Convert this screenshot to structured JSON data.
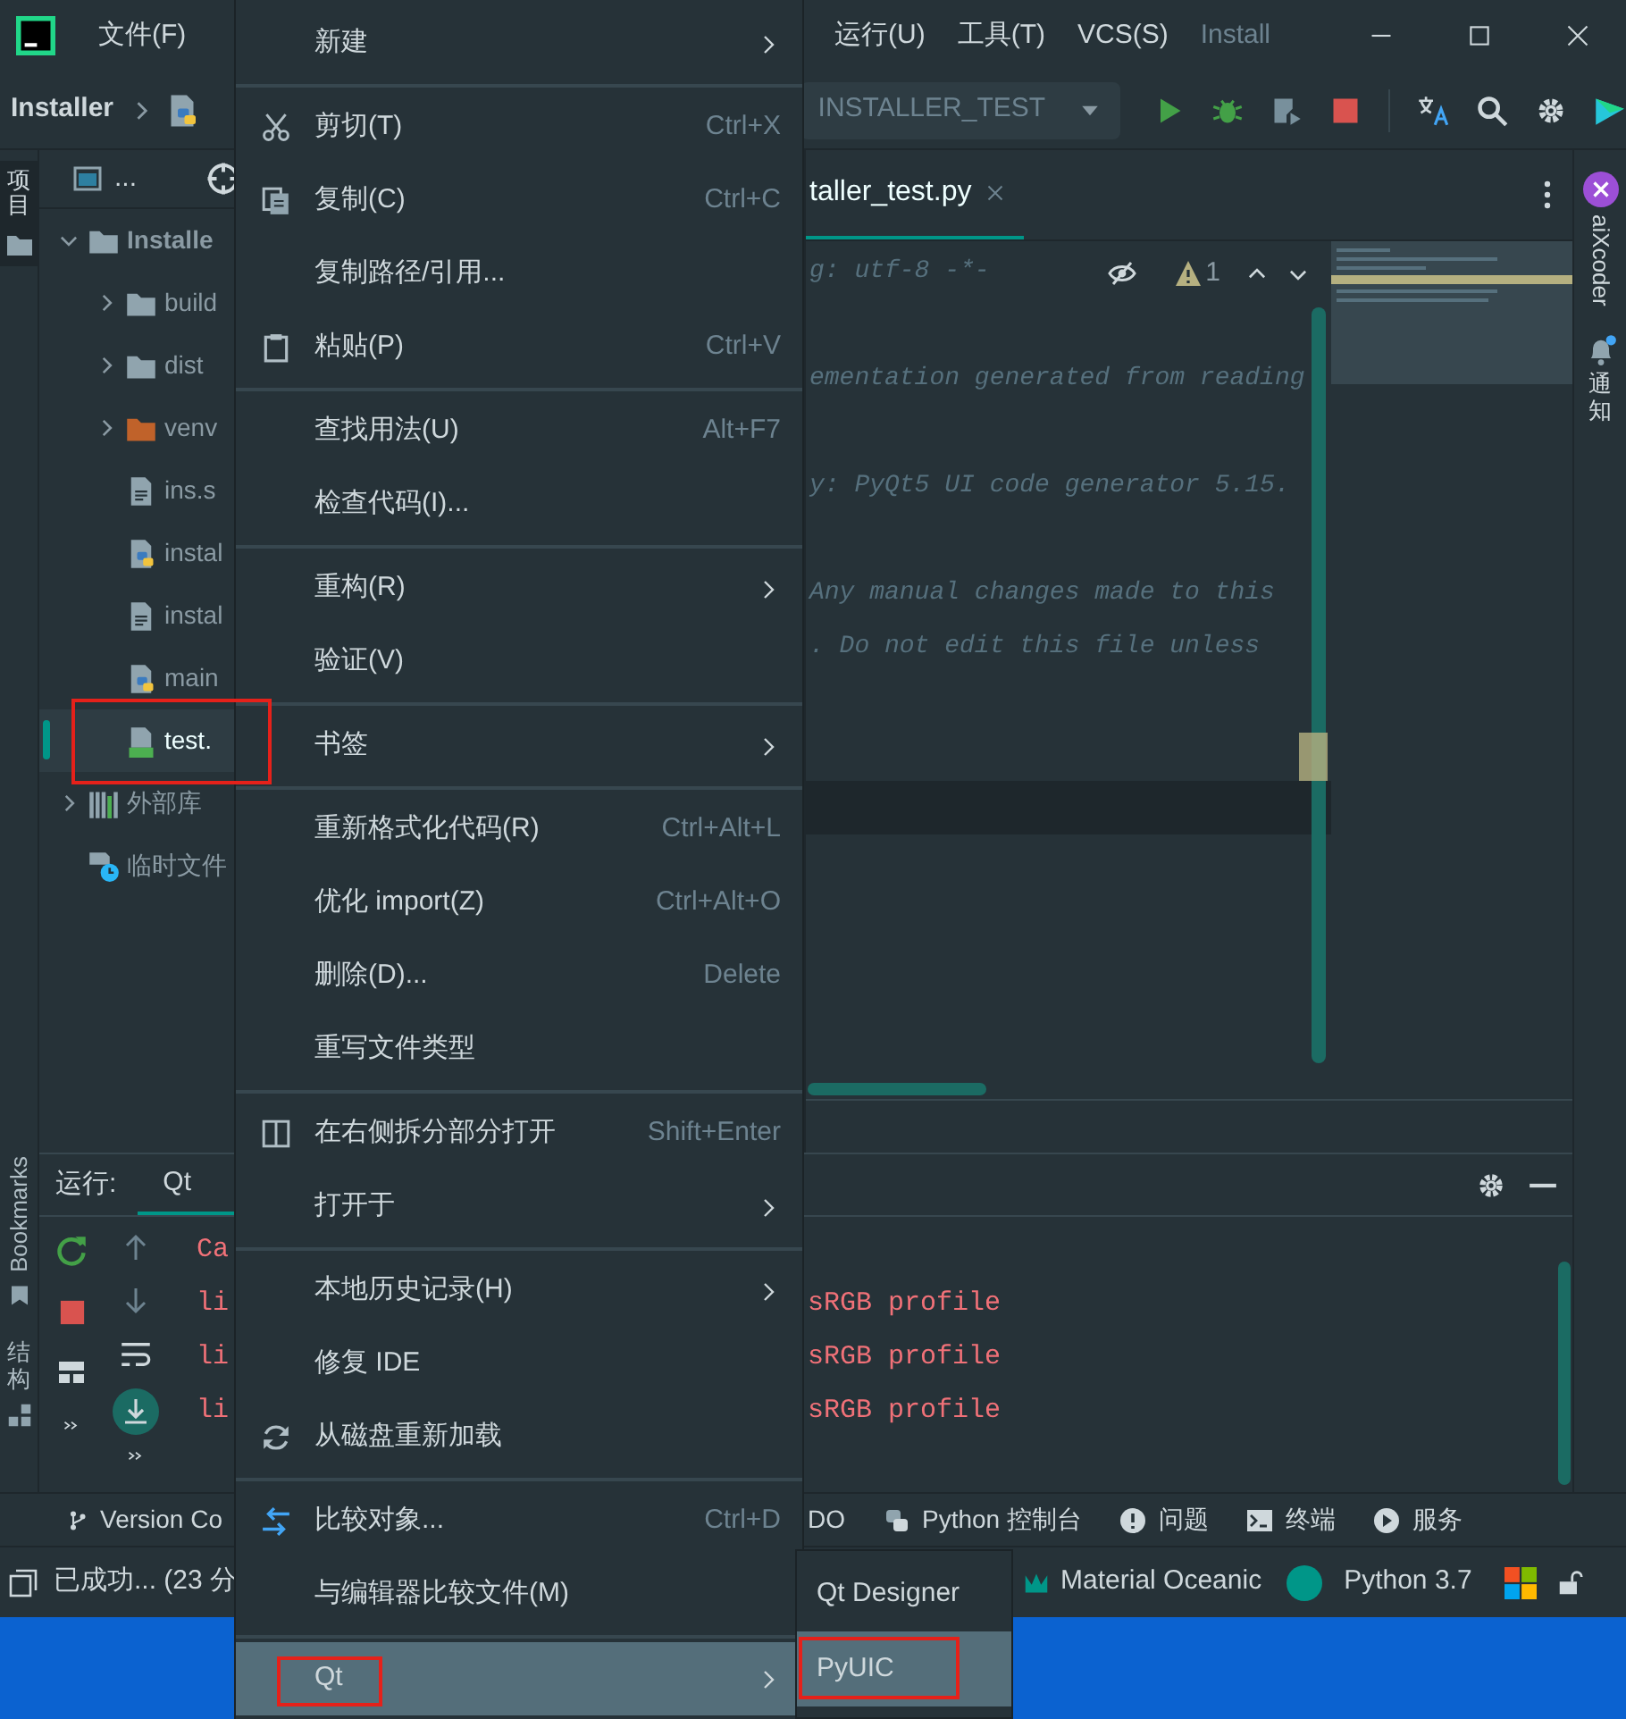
{
  "title_bar": {
    "menus_left": [
      "文件(F)"
    ],
    "menus_right": [
      "运行(U)",
      "工具(T)",
      "VCS(S)"
    ],
    "project": "Install"
  },
  "toolbar": {
    "breadcrumb": "Installer",
    "run_config": "INSTALLER_TEST"
  },
  "left_strip": {
    "top_tabs": [
      {
        "label": "项目",
        "selected": true
      }
    ],
    "bottom_tabs": [
      {
        "label": "Bookmarks",
        "selected": false
      },
      {
        "label": "结构",
        "selected": false
      }
    ]
  },
  "project_panel": {
    "view_selector": "...",
    "tree": [
      {
        "label": "Installe",
        "kind": "folder",
        "expanded": true,
        "selected": false,
        "annotated": false,
        "children": [
          {
            "label": "build",
            "kind": "folder",
            "expanded": false,
            "selected": false,
            "annotated": false
          },
          {
            "label": "dist",
            "kind": "folder",
            "expanded": false,
            "selected": false,
            "annotated": false
          },
          {
            "label": "venv",
            "kind": "excluded_folder",
            "expanded": false,
            "selected": false,
            "annotated": false
          },
          {
            "label": "ins.s",
            "kind": "file",
            "selected": false,
            "annotated": false
          },
          {
            "label": "instal",
            "kind": "python",
            "selected": false,
            "annotated": false
          },
          {
            "label": "instal",
            "kind": "file",
            "selected": false,
            "annotated": false
          },
          {
            "label": "main",
            "kind": "python",
            "selected": false,
            "annotated": false
          },
          {
            "label": "test.",
            "kind": "qt",
            "selected": true,
            "annotated": true
          }
        ]
      },
      {
        "label": "外部库",
        "kind": "library",
        "expanded": false,
        "selected": false,
        "annotated": false
      },
      {
        "label": "临时文件",
        "kind": "scratch",
        "selected": false,
        "annotated": false
      }
    ]
  },
  "editor": {
    "tab": {
      "label": "taller_test.py",
      "selected": true
    },
    "warnings": "1",
    "lines": [
      {
        "kind": "text",
        "text": "g: utf-8 -*-"
      },
      {
        "kind": "blank"
      },
      {
        "kind": "text",
        "text": "ementation generated from reading"
      },
      {
        "kind": "blank"
      },
      {
        "kind": "text",
        "text": "y: PyQt5 UI code generator 5.15."
      },
      {
        "kind": "blank"
      },
      {
        "kind": "text",
        "text": "Any manual changes made to this"
      },
      {
        "kind": "text",
        "text": ".  Do not edit this file unless"
      },
      {
        "kind": "blank"
      },
      {
        "kind": "blank"
      },
      {
        "kind": "current"
      }
    ]
  },
  "right_strip": [
    "aiXcoder",
    "通知"
  ],
  "run_panel": {
    "label": "运行:",
    "tab": {
      "label": "Qt",
      "selected": true
    },
    "output": [
      {
        "start": "Ca"
      },
      {
        "start": "li",
        "end": "sRGB profile"
      },
      {
        "start": "li",
        "end": "sRGB profile"
      },
      {
        "start": "li",
        "end": "sRGB profile"
      }
    ]
  },
  "tool_windows_left": [
    "Version Co"
  ],
  "tool_windows_right": [
    "DO",
    "Python 控制台",
    "问题",
    "终端",
    "服务"
  ],
  "status_bar": {
    "message": "已成功... (23 分",
    "theme": "Material Oceanic",
    "interpreter": "Python 3.7"
  },
  "context_menu": {
    "items": [
      {
        "kind": "item",
        "label": "新建",
        "submenu": true,
        "selected": false,
        "annotated": false
      },
      {
        "kind": "separator"
      },
      {
        "kind": "item",
        "label": "剪切(T)",
        "shortcut": "Ctrl+X",
        "submenu": false,
        "selected": false,
        "annotated": false
      },
      {
        "kind": "item",
        "label": "复制(C)",
        "shortcut": "Ctrl+C",
        "submenu": false,
        "selected": false,
        "annotated": false
      },
      {
        "kind": "item",
        "label": "复制路径/引用...",
        "submenu": false,
        "selected": false,
        "annotated": false
      },
      {
        "kind": "item",
        "label": "粘贴(P)",
        "shortcut": "Ctrl+V",
        "submenu": false,
        "selected": false,
        "annotated": false
      },
      {
        "kind": "separator"
      },
      {
        "kind": "item",
        "label": "查找用法(U)",
        "shortcut": "Alt+F7",
        "submenu": false,
        "selected": false,
        "annotated": false
      },
      {
        "kind": "item",
        "label": "检查代码(I)...",
        "submenu": false,
        "selected": false,
        "annotated": false
      },
      {
        "kind": "separator"
      },
      {
        "kind": "item",
        "label": "重构(R)",
        "submenu": true,
        "selected": false,
        "annotated": false
      },
      {
        "kind": "item",
        "label": "验证(V)",
        "submenu": false,
        "selected": false,
        "annotated": false
      },
      {
        "kind": "separator"
      },
      {
        "kind": "item",
        "label": "书签",
        "submenu": true,
        "selected": false,
        "annotated": false
      },
      {
        "kind": "separator"
      },
      {
        "kind": "item",
        "label": "重新格式化代码(R)",
        "shortcut": "Ctrl+Alt+L",
        "submenu": false,
        "selected": false,
        "annotated": false
      },
      {
        "kind": "item",
        "label": "优化 import(Z)",
        "shortcut": "Ctrl+Alt+O",
        "submenu": false,
        "selected": false,
        "annotated": false
      },
      {
        "kind": "item",
        "label": "删除(D)...",
        "shortcut": "Delete",
        "submenu": false,
        "selected": false,
        "annotated": false
      },
      {
        "kind": "item",
        "label": "重写文件类型",
        "submenu": false,
        "selected": false,
        "annotated": false
      },
      {
        "kind": "separator"
      },
      {
        "kind": "item",
        "label": "在右侧拆分部分打开",
        "shortcut": "Shift+Enter",
        "submenu": false,
        "selected": false,
        "annotated": false
      },
      {
        "kind": "item",
        "label": "打开于",
        "submenu": true,
        "selected": false,
        "annotated": false
      },
      {
        "kind": "separator"
      },
      {
        "kind": "item",
        "label": "本地历史记录(H)",
        "submenu": true,
        "selected": false,
        "annotated": false
      },
      {
        "kind": "item",
        "label": "修复 IDE",
        "submenu": false,
        "selected": false,
        "annotated": false
      },
      {
        "kind": "item",
        "label": "从磁盘重新加载",
        "submenu": false,
        "selected": false,
        "annotated": false
      },
      {
        "kind": "separator"
      },
      {
        "kind": "item",
        "label": "比较对象...",
        "shortcut": "Ctrl+D",
        "submenu": false,
        "selected": false,
        "annotated": false
      },
      {
        "kind": "item",
        "label": "与编辑器比较文件(M)",
        "submenu": false,
        "selected": false,
        "annotated": false
      },
      {
        "kind": "separator"
      },
      {
        "kind": "item",
        "label": "Qt",
        "submenu": true,
        "selected": true,
        "annotated": true
      }
    ]
  },
  "submenu": {
    "items": [
      {
        "label": "Qt Designer",
        "selected": false,
        "annotated": false
      },
      {
        "label": "PyUIC",
        "selected": true,
        "annotated": true
      }
    ]
  }
}
